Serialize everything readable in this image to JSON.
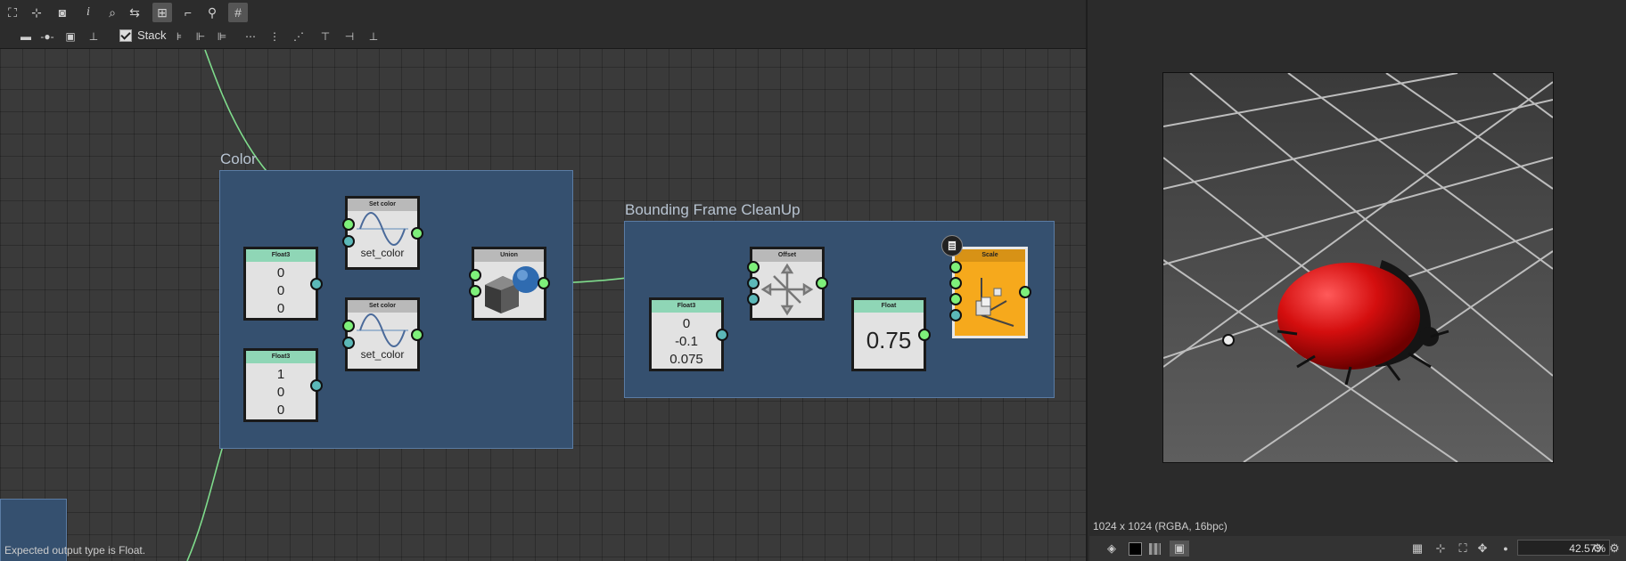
{
  "toolbar": {
    "row1_icons": [
      "fit-view-icon",
      "center-icon",
      "screenshot-icon",
      "info-icon",
      "search-icon",
      "connect-icon",
      "layout-icon",
      "link-icon",
      "brush-icon",
      "grid-icon"
    ],
    "row2_icons": [
      "comment-icon",
      "dot-icon",
      "frame-icon",
      "pin-icon"
    ],
    "stack_label": "Stack",
    "stack_checked": true,
    "align_icons": [
      "align-left-icon",
      "align-center-icon",
      "align-right-icon",
      "distribute-h-icon",
      "distribute-center-icon",
      "distribute-right-icon",
      "align-top-icon",
      "align-middle-icon",
      "align-bottom-icon"
    ]
  },
  "graph": {
    "frames": [
      {
        "title": "Color"
      },
      {
        "title": "Bounding Frame CleanUp"
      }
    ],
    "nodes": {
      "float3_a": {
        "header": "Float3",
        "values": [
          "0",
          "0",
          "0"
        ]
      },
      "float3_b": {
        "header": "Float3",
        "values": [
          "1",
          "0",
          "0"
        ]
      },
      "set_color_a": {
        "header": "Set color",
        "label": "set_color"
      },
      "set_color_b": {
        "header": "Set color",
        "label": "set_color"
      },
      "union": {
        "header": "Union"
      },
      "float3_c": {
        "header": "Float3",
        "values": [
          "0",
          "-0.1",
          "0.075"
        ]
      },
      "offset": {
        "header": "Offset"
      },
      "float": {
        "header": "Float",
        "value": "0.75"
      },
      "scale": {
        "header": "Scale"
      }
    }
  },
  "status": {
    "message": "Expected output type is Float."
  },
  "viewer": {
    "info": "1024 x 1024 (RGBA, 16bpc)",
    "zoom": "42.57%",
    "accent": "#d79216"
  }
}
